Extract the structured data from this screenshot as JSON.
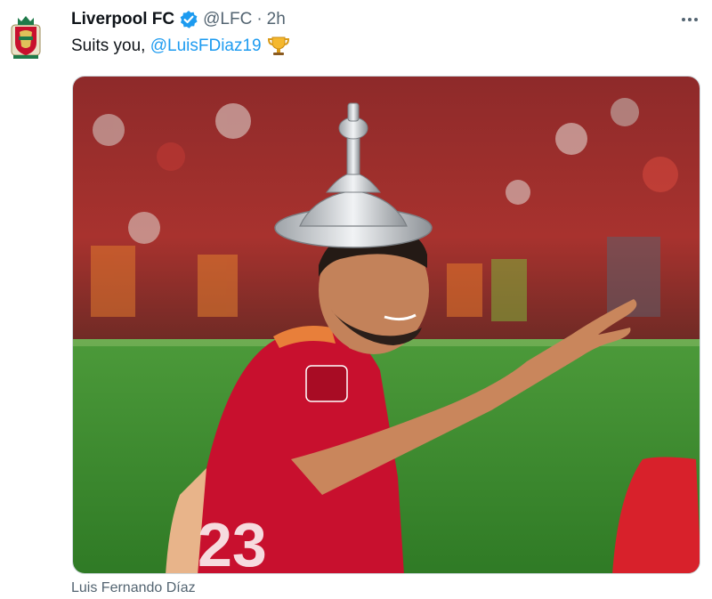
{
  "author": {
    "name": "Liverpool FC",
    "handle": "@LFC",
    "separator": "·",
    "time": "2h",
    "verified": true,
    "avatar_icon": "liverpool-crest-icon"
  },
  "tweet": {
    "text_prefix": "Suits you, ",
    "mention": "@LuisFDiaz19",
    "emoji_icon": "trophy-icon"
  },
  "media": {
    "caption": "Luis Fernando Díaz"
  },
  "colors": {
    "accent": "#1d9bf0",
    "secondary_text": "#536471",
    "primary_text": "#0f1419",
    "pitch_green": "#3a8a2e",
    "jersey_red": "#c8102e"
  }
}
